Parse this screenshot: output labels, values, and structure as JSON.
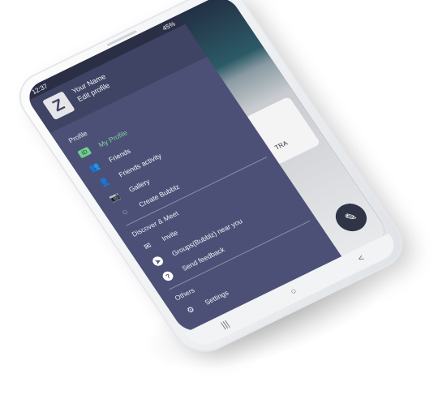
{
  "status_bar": {
    "time": "12:37",
    "battery": "45%"
  },
  "profile_header": {
    "logo_letter": "Z",
    "name": "Your Name",
    "edit": "Edit profile"
  },
  "sections": {
    "profile": "Profile",
    "discover": "Discover & Meet",
    "others": "Others"
  },
  "menu": {
    "my_profile": "My Profile",
    "friends": "Friends",
    "friends_activity": "Friends activity",
    "gallery": "Gallery",
    "create_bubblz": "Create Bubblz",
    "invite": "Invite",
    "groups_near": "Groups(Bubblz) near you",
    "send_feedback": "Send feedback",
    "settings": "Settings"
  },
  "background_app": {
    "card_label": "TRA"
  },
  "colors": {
    "drawer": "#4c5077",
    "header": "#3f4465",
    "active": "#7fd39a"
  },
  "nav": {
    "recent": "|||",
    "home": "○",
    "back": "<"
  }
}
